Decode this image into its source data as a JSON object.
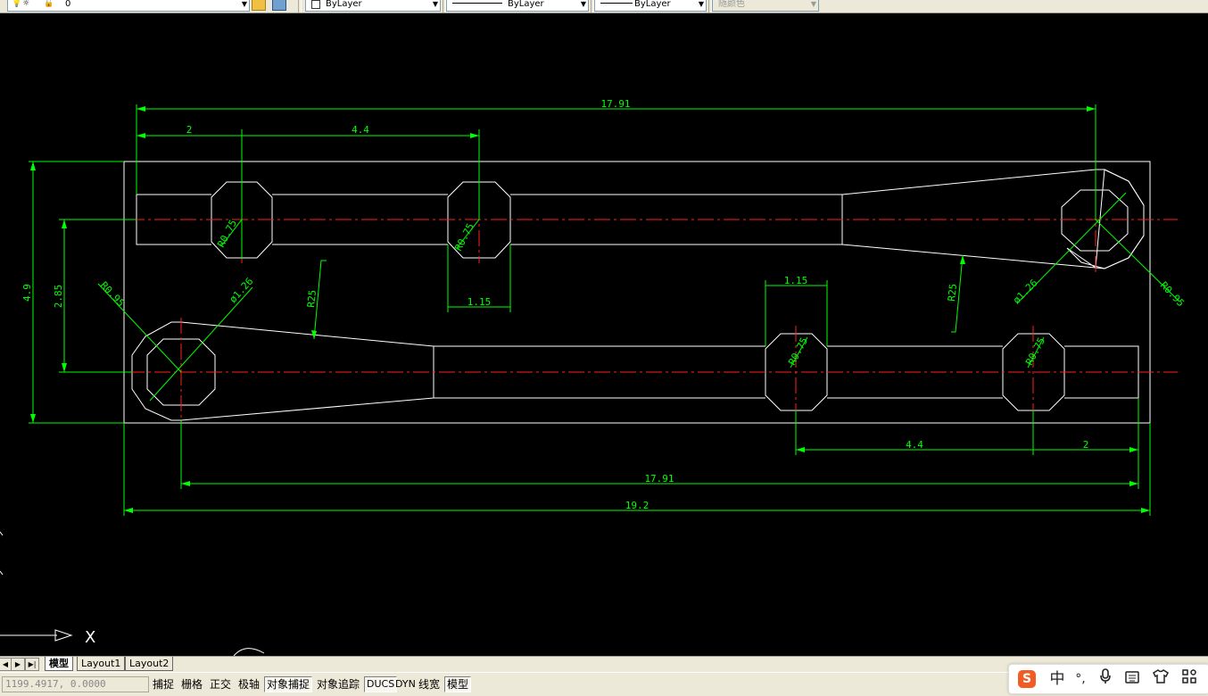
{
  "toolbar": {
    "layer_value": "0",
    "color_value": "ByLayer",
    "linetype_value": "ByLayer",
    "lineweight_value": "ByLayer",
    "plotstyle_value": "随颜色"
  },
  "drawing": {
    "dim_texts": {
      "top_overall": "17.91",
      "top_left_2": "2",
      "top_left_44": "4.4",
      "left_49": "4.9",
      "left_285": "2.85",
      "r095_left": "R0.95",
      "phi126_left": "ø1.26",
      "r75_upper_left": "R0.75",
      "r75_upper_mid": "R0.75",
      "r25_left": "R25",
      "w115_upper": "1.15",
      "w115_lower": "1.15",
      "r75_lower_mid": "R0.75",
      "r75_lower_right": "R0.75",
      "r25_right": "R25",
      "phi126_right": "ø1.26",
      "r095_right": "R0.95",
      "bottom_44": "4.4",
      "bottom_2": "2",
      "bottom_1791": "17.91",
      "bottom_192": "19.2"
    },
    "ucs_x_label": "X"
  },
  "layout_tabs": {
    "model": "模型",
    "layout1": "Layout1",
    "layout2": "Layout2"
  },
  "status": {
    "coords": "1199.4917, 0.0000",
    "snap": "捕捉",
    "grid": "栅格",
    "ortho": "正交",
    "polar": "极轴",
    "osnap": "对象捕捉",
    "otrack": "对象追踪",
    "ducs": "DUCS",
    "dyn": "DYN",
    "lwt": "线宽",
    "model": "模型"
  },
  "ime": {
    "logo": "S",
    "lang": "中",
    "punct": "°,"
  },
  "colors": {
    "canvas_bg": "#000000",
    "outline": "#ffffff",
    "dimension": "#00ff00",
    "centerline": "#ff0000",
    "chrome": "#ece9d8"
  }
}
